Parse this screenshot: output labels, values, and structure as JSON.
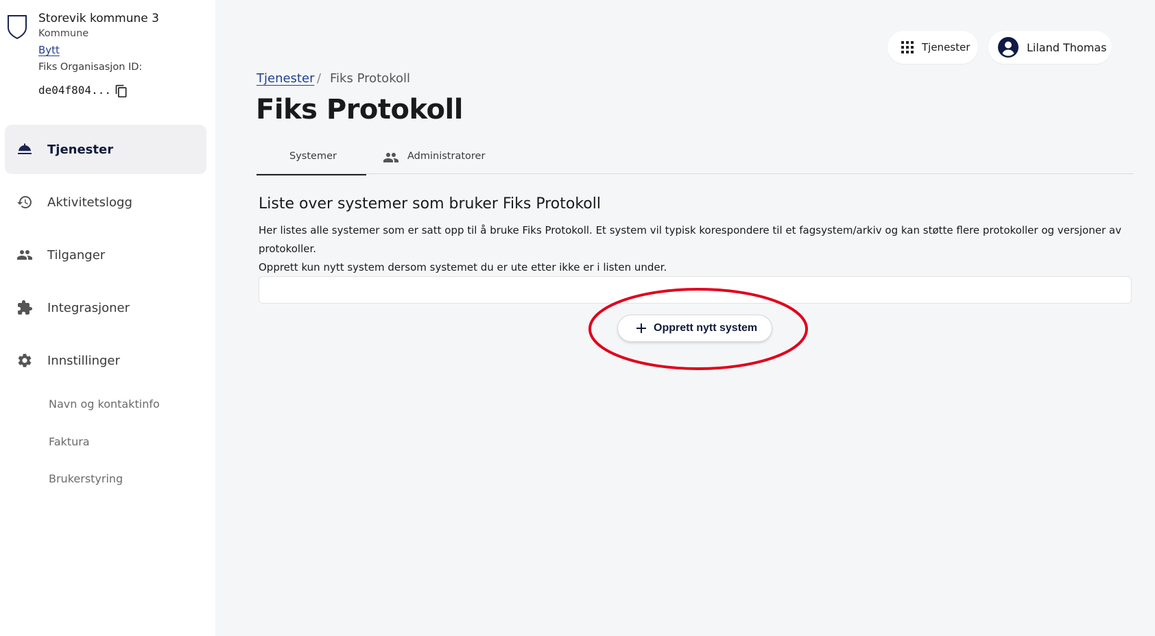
{
  "organization": {
    "name": "Storevik kommune 3",
    "type": "Kommune",
    "switch_label": "Bytt",
    "id_label": "Fiks Organisasjon ID:",
    "id_value": "de04f804..."
  },
  "sidebar": {
    "items": [
      {
        "label": "Tjenester",
        "icon": "service-bell-icon",
        "active": true
      },
      {
        "label": "Aktivitetslogg",
        "icon": "history-icon",
        "active": false
      },
      {
        "label": "Tilganger",
        "icon": "people-icon",
        "active": false
      },
      {
        "label": "Integrasjoner",
        "icon": "puzzle-icon",
        "active": false
      },
      {
        "label": "Innstillinger",
        "icon": "gear-icon",
        "active": false
      }
    ],
    "sub_items": [
      {
        "label": "Navn og kontaktinfo"
      },
      {
        "label": "Faktura"
      },
      {
        "label": "Brukerstyring"
      }
    ]
  },
  "header": {
    "services_label": "Tjenester",
    "user_name": "Liland Thomas"
  },
  "breadcrumb": {
    "parent": "Tjenester",
    "separator": "/",
    "current": "Fiks Protokoll"
  },
  "page": {
    "title": "Fiks Protokoll",
    "tabs": [
      {
        "label": "Systemer",
        "active": true
      },
      {
        "label": "Administratorer",
        "active": false
      }
    ],
    "section_heading": "Liste over systemer som bruker Fiks Protokoll",
    "section_description_1": "Her listes alle systemer som er satt opp til å bruke Fiks Protokoll. Et system vil typisk korespondere til et fagsystem/arkiv og kan støtte flere protokoller og versjoner av protokoller.",
    "section_description_2": "Opprett kun nytt system dersom systemet du er ute etter ikke er i listen under.",
    "create_button_label": "Opprett nytt system"
  },
  "colors": {
    "accent_link": "#1f3f8f",
    "highlight": "#e0001b",
    "nav_active_bg": "#f0f0f3",
    "page_bg": "#f5f6f8"
  }
}
